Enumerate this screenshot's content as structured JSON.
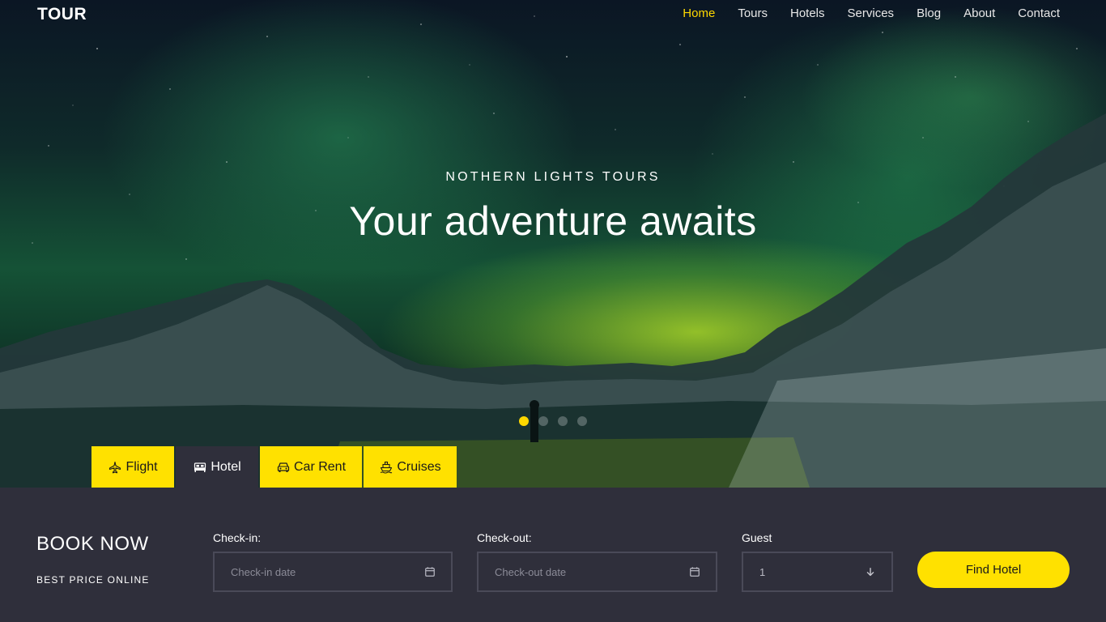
{
  "brand": {
    "logo": "TOUR"
  },
  "nav": {
    "items": [
      {
        "label": "Home",
        "active": true
      },
      {
        "label": "Tours"
      },
      {
        "label": "Hotels"
      },
      {
        "label": "Services"
      },
      {
        "label": "Blog"
      },
      {
        "label": "About"
      },
      {
        "label": "Contact"
      }
    ],
    "active_color": "#ffd800"
  },
  "hero": {
    "subtitle": "NOTHERN LIGHTS TOURS",
    "title": "Your adventure awaits",
    "slides": {
      "count": 4,
      "active_index": 0
    }
  },
  "tabs": [
    {
      "label": "Flight",
      "icon": "airplane-icon",
      "active": false
    },
    {
      "label": "Hotel",
      "icon": "hotel-bed-icon",
      "active": true
    },
    {
      "label": "Car Rent",
      "icon": "car-icon",
      "active": false
    },
    {
      "label": "Cruises",
      "icon": "ship-icon",
      "active": false
    }
  ],
  "booking": {
    "title": "BOOK NOW",
    "subtitle": "BEST PRICE ONLINE",
    "checkin": {
      "label": "Check-in:",
      "placeholder": "Check-in date",
      "icon": "calendar-icon"
    },
    "checkout": {
      "label": "Check-out:",
      "placeholder": "Check-out date",
      "icon": "calendar-icon"
    },
    "guest": {
      "label": "Guest",
      "value": "1",
      "icon": "arrow-down-icon"
    },
    "submit_label": "Find Hotel"
  },
  "colors": {
    "accent": "#ffe100",
    "panel": "#2f2f3b",
    "field_border": "#4a4a58"
  }
}
